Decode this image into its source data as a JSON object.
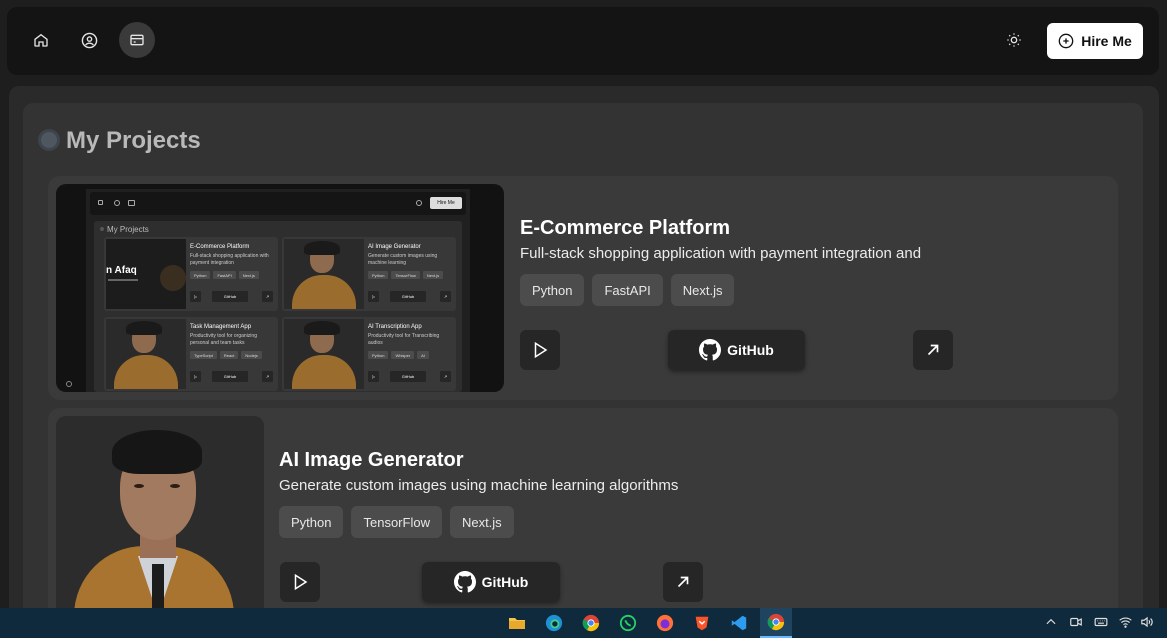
{
  "nav": {
    "hire_label": "Hire Me"
  },
  "section": {
    "title": "My Projects"
  },
  "projects": [
    {
      "title": "E-Commerce Platform",
      "description": "Full-stack shopping application with payment integration and",
      "tags": [
        "Python",
        "FastAPI",
        "Next.js"
      ],
      "github_label": "GitHub"
    },
    {
      "title": "AI Image Generator",
      "description": "Generate custom images using machine learning algorithms",
      "tags": [
        "Python",
        "TensorFlow",
        "Next.js"
      ],
      "github_label": "GitHub"
    }
  ],
  "preview": {
    "hire_label": "Hire Me",
    "section_title": "My Projects",
    "hero_text": "n Afaq",
    "cards": [
      {
        "title": "E-Commerce Platform",
        "desc": "Full-stack shopping application with payment integration",
        "tags": [
          "Python",
          "FastAPI",
          "Next.js"
        ],
        "github": "GitHub"
      },
      {
        "title": "AI Image Generator",
        "desc": "Generate custom images using machine learning",
        "tags": [
          "Python",
          "TensorFlow",
          "Next.js"
        ],
        "github": "GitHub"
      },
      {
        "title": "Task Management App",
        "desc": "Productivity tool for organizing personal and team tasks",
        "tags": [
          "TypeScript",
          "React",
          "Nodejs"
        ],
        "github": "GitHub"
      },
      {
        "title": "AI Transcription App",
        "desc": "Productivity tool for Transcribing audios",
        "tags": [
          "Python",
          "Whisper",
          "AI"
        ],
        "github": "GitHub"
      }
    ]
  },
  "colors": {
    "accent": "#ffffff",
    "card_bg": "#3a3a3a",
    "taskbar": "#0f2a3d"
  },
  "taskbar_icons": [
    "file-explorer-icon",
    "edge-icon",
    "chrome-icon",
    "whatsapp-icon",
    "firefox-icon",
    "brave-icon",
    "vscode-icon",
    "chrome-active-icon"
  ]
}
